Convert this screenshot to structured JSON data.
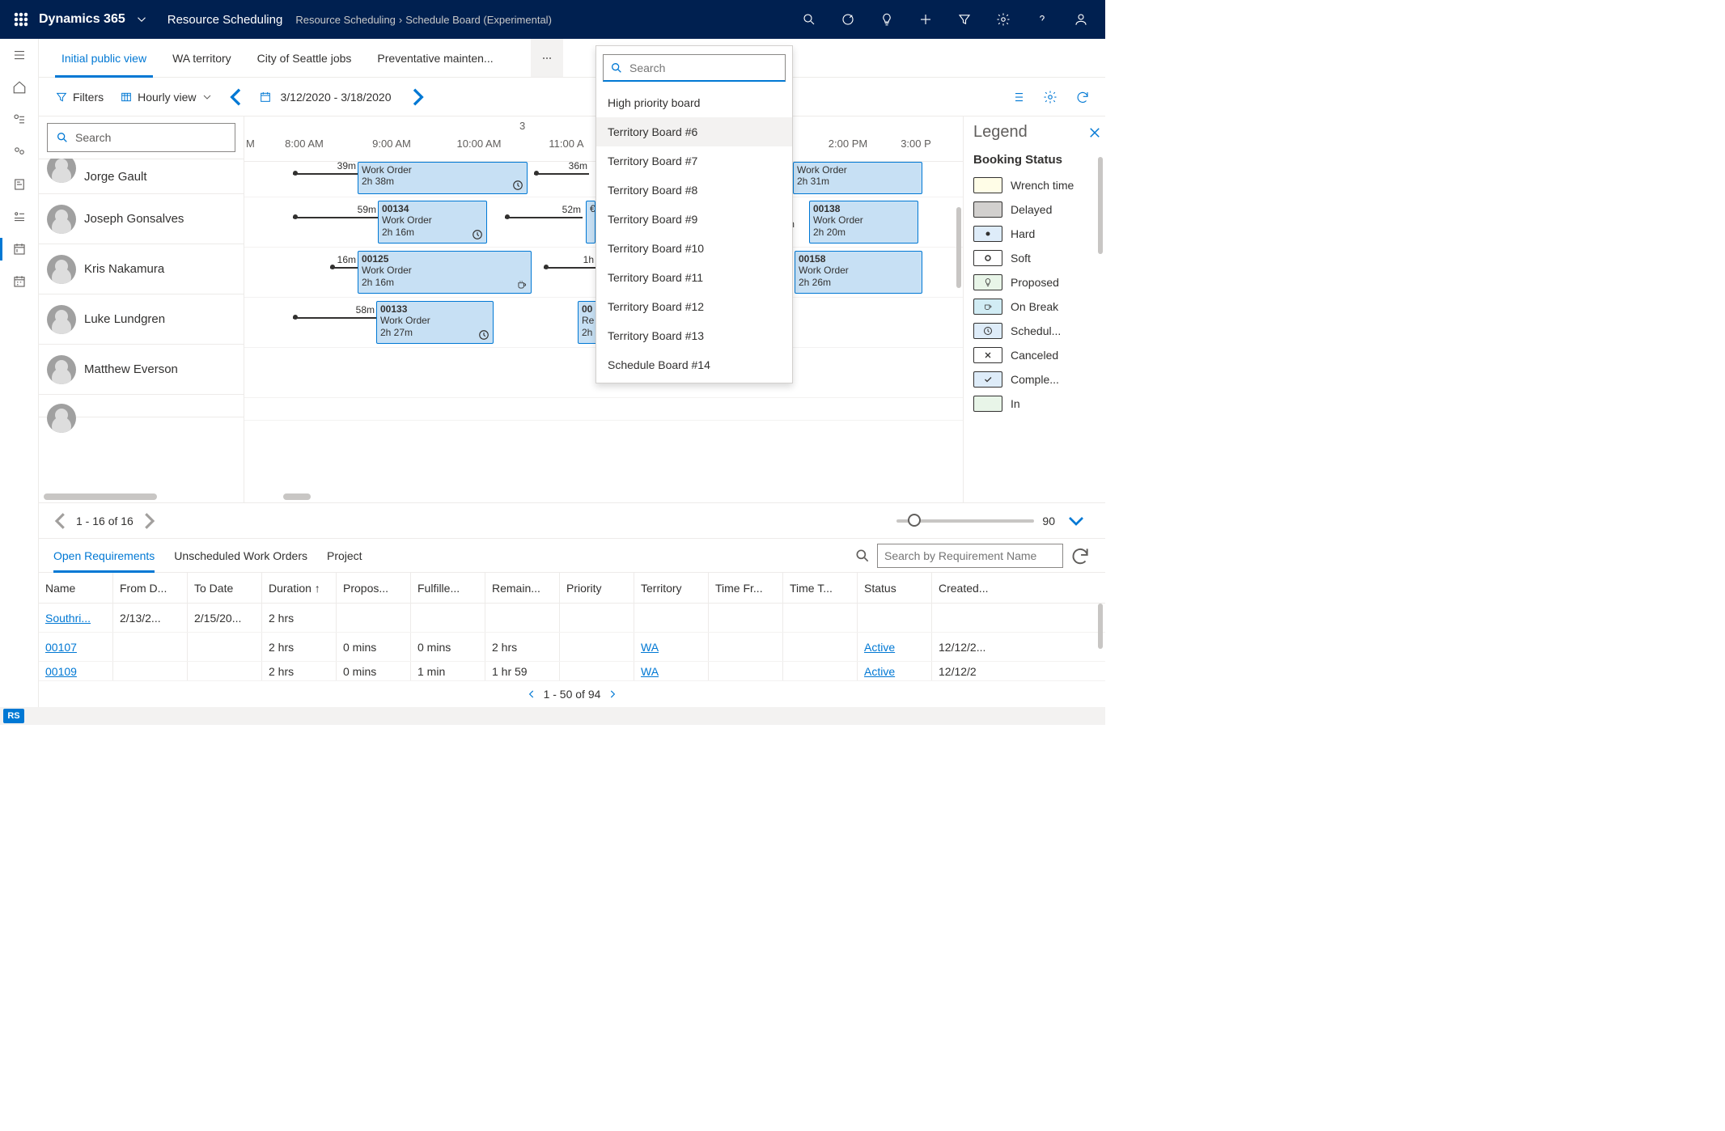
{
  "topbar": {
    "brand": "Dynamics 365",
    "area": "Resource Scheduling",
    "breadcrumb": [
      "Resource Scheduling",
      "Schedule Board (Experimental)"
    ]
  },
  "tabs": {
    "items": [
      "Initial public view",
      "WA territory",
      "City of Seattle jobs",
      "Preventative mainten..."
    ],
    "activeIndex": 0
  },
  "tabDropdown": {
    "searchPlaceholder": "Search",
    "items": [
      "High priority board",
      "Territory Board #6",
      "Territory Board #7",
      "Territory Board #8",
      "Territory Board #9",
      "Territory Board #10",
      "Territory Board #11",
      "Territory Board #12",
      "Territory Board #13",
      "Schedule Board #14"
    ],
    "hoverIndex": 1
  },
  "toolbar": {
    "filters": "Filters",
    "viewMode": "Hourly view",
    "dateRange": "3/12/2020 - 3/18/2020"
  },
  "resourceSearch": {
    "placeholder": "Search"
  },
  "resources": [
    {
      "name": "Jorge Gault"
    },
    {
      "name": "Joseph Gonsalves"
    },
    {
      "name": "Kris Nakamura"
    },
    {
      "name": "Luke Lundgren"
    },
    {
      "name": "Matthew Everson"
    }
  ],
  "timeline": {
    "dayLabel": "3",
    "ticks": [
      "M",
      "8:00 AM",
      "9:00 AM",
      "10:00 AM",
      "11:00 A",
      "",
      "2:00 PM",
      "3:00 P"
    ]
  },
  "bookings": {
    "row0": {
      "travel": "39m",
      "b1": {
        "type": "Work Order",
        "dur": "2h 38m",
        "icon": "clock"
      },
      "travel2": "36m",
      "b2": {
        "type": "Work Order",
        "dur": "2h 31m"
      }
    },
    "row1": {
      "travel": "59m",
      "b1": {
        "id": "00134",
        "type": "Work Order",
        "dur": "2h 16m",
        "icon": "clock"
      },
      "travel2": "52m",
      "extra": "€",
      "travelR": "m",
      "b2": {
        "id": "00138",
        "type": "Work Order",
        "dur": "2h 20m"
      }
    },
    "row2": {
      "travel": "16m",
      "b1": {
        "id": "00125",
        "type": "Work Order",
        "dur": "2h 16m",
        "icon": "cup"
      },
      "travel2": "1h",
      "b2": {
        "id": "00158",
        "type": "Work Order",
        "dur": "2h 26m"
      }
    },
    "row3": {
      "travel": "58m",
      "b1": {
        "id": "00133",
        "type": "Work Order",
        "dur": "2h 27m",
        "icon": "clock"
      },
      "b2": {
        "id": "00",
        "type": "Re",
        "dur": "2h"
      }
    },
    "row4": {}
  },
  "legend": {
    "title": "Legend",
    "subtitle": "Booking Status",
    "items": [
      {
        "label": "Wrench time",
        "swatch": "#fffde7",
        "icon": ""
      },
      {
        "label": "Delayed",
        "swatch": "#d2d0ce",
        "icon": ""
      },
      {
        "label": "Hard",
        "swatch": "#deecf9",
        "icon": "dot"
      },
      {
        "label": "Soft",
        "swatch": "#ffffff",
        "icon": "ring"
      },
      {
        "label": "Proposed",
        "swatch": "#e8f5e8",
        "icon": "bulb"
      },
      {
        "label": "On Break",
        "swatch": "#d1ecf4",
        "icon": "cup"
      },
      {
        "label": "Schedul...",
        "swatch": "#deecf9",
        "icon": "clock"
      },
      {
        "label": "Canceled",
        "swatch": "#ffffff",
        "icon": "x"
      },
      {
        "label": "Comple...",
        "swatch": "#deecf9",
        "icon": "check"
      },
      {
        "label": "In",
        "swatch": "#e8f5e8",
        "icon": ""
      }
    ]
  },
  "paging": {
    "text": "1 - 16 of 16",
    "zoomValue": "90"
  },
  "bottom": {
    "tabs": [
      "Open Requirements",
      "Unscheduled Work Orders",
      "Project"
    ],
    "activeIndex": 0,
    "searchPlaceholder": "Search by Requirement Name",
    "columns": [
      "Name",
      "From D...",
      "To Date",
      "Duration ↑",
      "Propos...",
      "Fulfille...",
      "Remain...",
      "Priority",
      "Territory",
      "Time Fr...",
      "Time T...",
      "Status",
      "Created..."
    ],
    "rows": [
      {
        "name": "Southri...",
        "from": "2/13/2...",
        "to": "2/15/20...",
        "dur": "2 hrs",
        "prop": "",
        "fulf": "",
        "rem": "",
        "prio": "",
        "terr": "",
        "tf": "",
        "tt": "",
        "status": "",
        "created": ""
      },
      {
        "name": "00107",
        "from": "",
        "to": "",
        "dur": "2 hrs",
        "prop": "0 mins",
        "fulf": "0 mins",
        "rem": "2 hrs",
        "prio": "",
        "terr": "WA",
        "tf": "",
        "tt": "",
        "status": "Active",
        "created": "12/12/2..."
      },
      {
        "name": "00109",
        "from": "",
        "to": "",
        "dur": "2 hrs",
        "prop": "0 mins",
        "fulf": "1 min",
        "rem": "1 hr 59",
        "prio": "",
        "terr": "WA",
        "tf": "",
        "tt": "",
        "status": "Active",
        "created": "12/12/2"
      }
    ],
    "footer": "1 - 50 of 94"
  },
  "statusbar": {
    "badge": "RS"
  }
}
